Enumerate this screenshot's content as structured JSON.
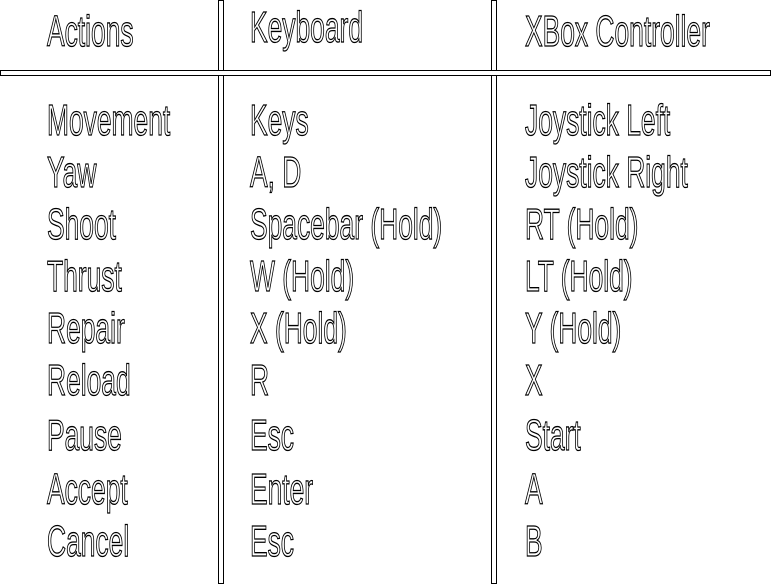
{
  "headers": [
    "Actions",
    "Keyboard",
    "XBox Controller"
  ],
  "rows": [
    {
      "action": "Movement",
      "keyboard": "Keys",
      "controller": "Joystick Left"
    },
    {
      "action": "Yaw",
      "keyboard": "A, D",
      "controller": "Joystick Right"
    },
    {
      "action": "Shoot",
      "keyboard": "Spacebar (Hold)",
      "controller": "RT (Hold)"
    },
    {
      "action": "Thrust",
      "keyboard": "W (Hold)",
      "controller": "LT (Hold)"
    },
    {
      "action": "Repair",
      "keyboard": "X (Hold)",
      "controller": "Y (Hold)"
    },
    {
      "action": "Reload",
      "keyboard": "R",
      "controller": "X"
    },
    {
      "action": "Pause",
      "keyboard": "Esc",
      "controller": "Start"
    },
    {
      "action": "Accept",
      "keyboard": "Enter",
      "controller": "A"
    },
    {
      "action": "Cancel",
      "keyboard": "Esc",
      "controller": "B"
    }
  ]
}
